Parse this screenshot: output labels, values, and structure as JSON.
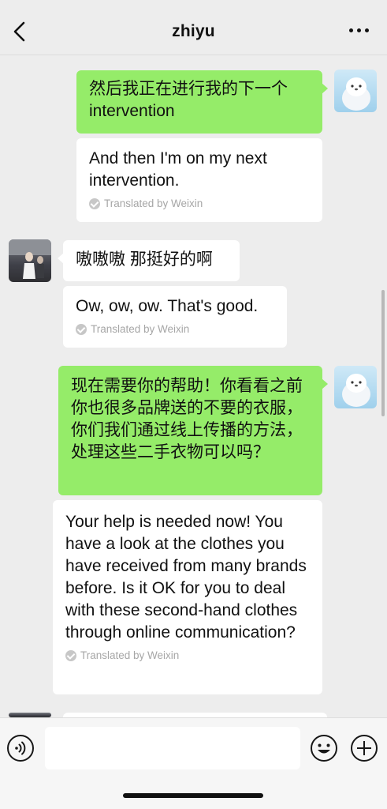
{
  "header": {
    "title": "zhiyu",
    "back_icon": "chevron-left-icon",
    "more_icon": "more-dots-icon"
  },
  "messages": [
    {
      "side": "me",
      "original": "然后我正在进行我的下一个intervention",
      "translation": "And then I'm on my next intervention.",
      "translated_label": "Translated by Weixin"
    },
    {
      "side": "other",
      "original": "嗷嗷嗷 那挺好的啊",
      "translation": "Ow, ow, ow. That's good.",
      "translated_label": "Translated by Weixin"
    },
    {
      "side": "me",
      "original": "现在需要你的帮助！你看看之前你也很多品牌送的不要的衣服，你们我们通过线上传播的方法，处理这些二手衣物可以吗？",
      "translation": "Your help is needed now! You have a look at the clothes you have received from many brands before. Is it OK for you to deal with these second-hand clothes through online communication?",
      "translated_label": "Translated by Weixin"
    }
  ],
  "input": {
    "value": "",
    "voice_icon": "voice-icon",
    "emoji_icon": "emoji-icon",
    "plus_icon": "plus-icon"
  },
  "colors": {
    "background": "#ededed",
    "bubble_me": "#95ec69",
    "bubble_other": "#ffffff",
    "translated_text": "#a6a6a6"
  }
}
